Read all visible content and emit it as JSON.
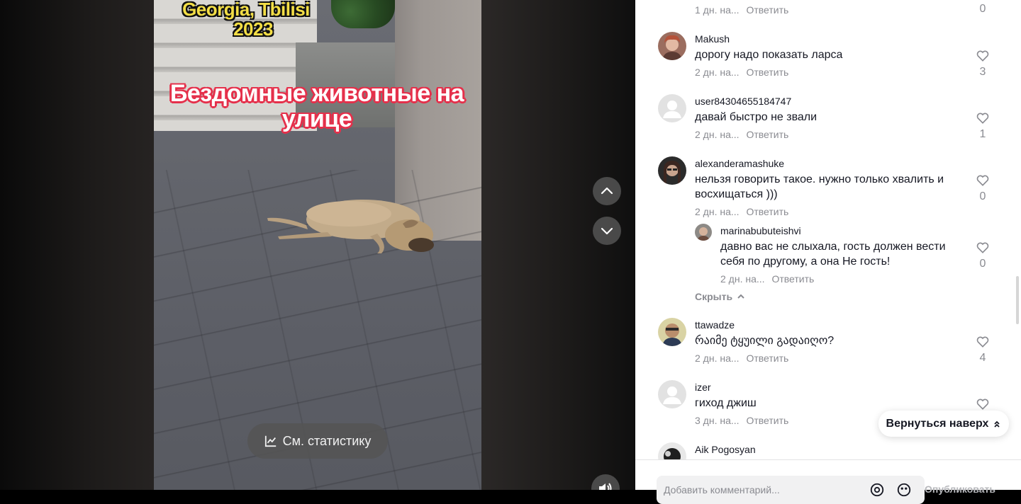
{
  "video": {
    "location_line1": "Georgia, Tbilisi",
    "location_line2": "2023",
    "headline": "Бездомные животные на улице",
    "stats_button": "См. статистику"
  },
  "comments": [
    {
      "username": "",
      "text": "",
      "date": "1 дн. на...",
      "reply": "Ответить",
      "likes": "0"
    },
    {
      "username": "Makush",
      "text": "дорогу надо показать ларса",
      "date": "2 дн. на...",
      "reply": "Ответить",
      "likes": "3"
    },
    {
      "username": "user84304655184747",
      "text": "давай быстро не звали",
      "date": "2 дн. на...",
      "reply": "Ответить",
      "likes": "1"
    },
    {
      "username": "alexanderamashuke",
      "text": "нельзя говорить такое. нужно только хвалить и восхищаться )))",
      "date": "2 дн. на...",
      "reply": "Ответить",
      "likes": "0"
    },
    {
      "username": "marinabubuteishvi",
      "text": "давно вас не слыхала, гость должен вести себя по другому, а она Не гость!",
      "date": "2 дн. на...",
      "reply": "Ответить",
      "likes": "0"
    },
    {
      "username": "ttawadze",
      "text": "რაიმე ტყუილი გადაიღო?",
      "date": "2 дн. на...",
      "reply": "Ответить",
      "likes": "4"
    },
    {
      "username": "izer",
      "text": "гиход джиш",
      "date": "3 дн. на...",
      "reply": "Ответить",
      "likes": ""
    },
    {
      "username": "Aik Pogosyan",
      "text": "",
      "date": "",
      "reply": "",
      "likes": ""
    }
  ],
  "hide_replies": "Скрыть",
  "back_to_top": "Вернуться наверх",
  "footer": {
    "placeholder": "Добавить комментарий...",
    "publish": "Опубликовать"
  },
  "colors": {
    "headline_outline": "#e5304b",
    "location_text": "#f3de46",
    "text_primary": "#161823",
    "text_secondary": "#8a8b91"
  }
}
